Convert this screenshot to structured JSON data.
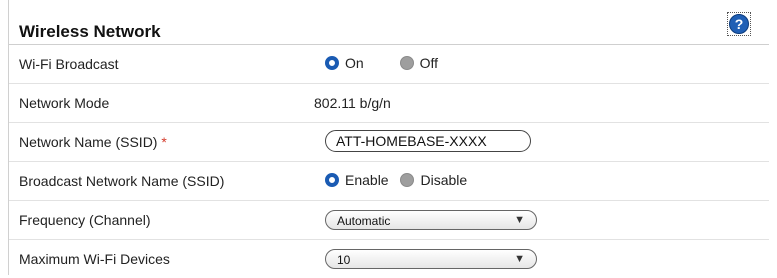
{
  "header": {
    "title": "Wireless Network",
    "help_icon": "help-icon",
    "help_glyph": "?"
  },
  "rows": {
    "wifi_broadcast": {
      "label": "Wi-Fi Broadcast",
      "options": [
        "On",
        "Off"
      ],
      "selected": "On"
    },
    "network_mode": {
      "label": "Network Mode",
      "value": "802.11 b/g/n"
    },
    "network_name": {
      "label": "Network Name (SSID)",
      "required_marker": "*",
      "value": "ATT-HOMEBASE-XXXX"
    },
    "broadcast_ssid": {
      "label": "Broadcast Network Name (SSID)",
      "options": [
        "Enable",
        "Disable"
      ],
      "selected": "Enable"
    },
    "frequency": {
      "label": "Frequency (Channel)",
      "value": "Automatic"
    },
    "max_devices": {
      "label": "Maximum Wi-Fi Devices",
      "value": "10"
    }
  },
  "colors": {
    "radio_selected": "#1a5bb3",
    "radio_unselected": "#9e9e9e",
    "required": "#d43a2a",
    "help_blue": "#1f5fb5"
  }
}
